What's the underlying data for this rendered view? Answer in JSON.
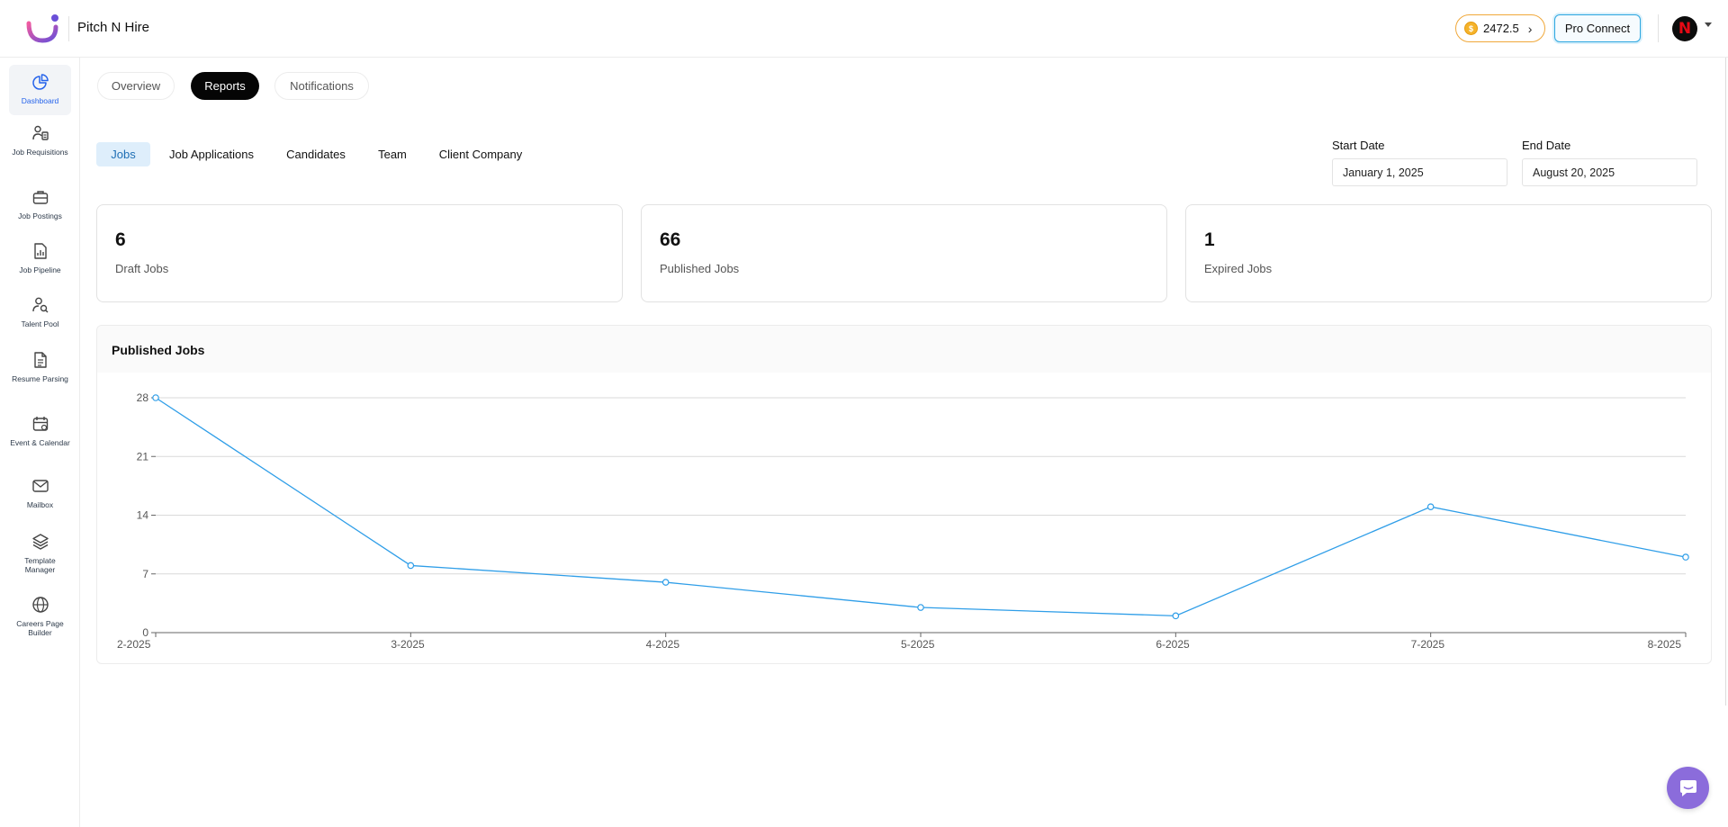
{
  "header": {
    "brand": "Pitch N Hire",
    "coins": "2472.5",
    "coin_symbol": "$",
    "pro_connect": "Pro Connect",
    "avatar_letter": "N"
  },
  "sidebar": {
    "items": [
      {
        "label": "Dashboard",
        "icon": "dashboard-icon",
        "active": true
      },
      {
        "label": "Job Requisitions",
        "icon": "job-requisitions-icon"
      },
      {
        "label": "Job Postings",
        "icon": "briefcase-icon"
      },
      {
        "label": "Job Pipeline",
        "icon": "pipeline-icon"
      },
      {
        "label": "Talent Pool",
        "icon": "talent-search-icon"
      },
      {
        "label": "Resume Parsing",
        "icon": "resume-icon"
      },
      {
        "label": "Event & Calendar",
        "icon": "calendar-icon"
      },
      {
        "label": "Mailbox",
        "icon": "mail-icon"
      },
      {
        "label": "Template Manager",
        "icon": "layers-icon"
      },
      {
        "label": "Careers Page Builder",
        "icon": "globe-icon"
      }
    ]
  },
  "tabs": {
    "overview": "Overview",
    "reports": "Reports",
    "notifications": "Notifications"
  },
  "subtabs": {
    "jobs": "Jobs",
    "job_applications": "Job Applications",
    "candidates": "Candidates",
    "team": "Team",
    "client_company": "Client Company"
  },
  "dates": {
    "start_label": "Start Date",
    "start_value": "January 1, 2025",
    "end_label": "End Date",
    "end_value": "August 20, 2025"
  },
  "cards": [
    {
      "value": "6",
      "label": "Draft Jobs"
    },
    {
      "value": "66",
      "label": "Published Jobs"
    },
    {
      "value": "1",
      "label": "Expired Jobs"
    }
  ],
  "chart": {
    "title": "Published Jobs"
  },
  "chart_data": {
    "type": "line",
    "title": "Published Jobs",
    "x": [
      "2-2025",
      "3-2025",
      "4-2025",
      "5-2025",
      "6-2025",
      "7-2025",
      "8-2025"
    ],
    "series": [
      {
        "values": [
          28,
          8,
          6,
          3,
          2,
          15,
          9
        ]
      }
    ],
    "yticks": [
      0,
      7,
      14,
      21,
      28
    ],
    "ylim": [
      0,
      28
    ],
    "grid": true,
    "line_color": "#2f9ee8"
  },
  "colors": {
    "accent_blue": "#2f9ee8",
    "active_tab_bg": "#050505",
    "coin_border": "#f0a83a",
    "chat_purple": "#8b6cdb"
  }
}
